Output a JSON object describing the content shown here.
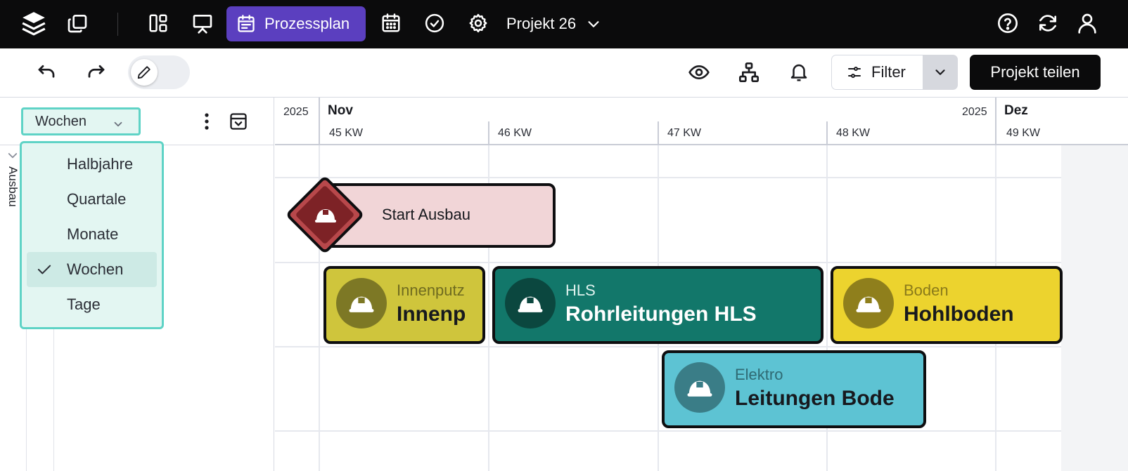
{
  "topbar": {
    "active_tab_label": "Prozessplan",
    "project_name": "Projekt 26"
  },
  "toolbar": {
    "filter_label": "Filter",
    "share_label": "Projekt teilen"
  },
  "left_panel": {
    "view_select_value": "Wochen",
    "group_label": "Ausbau"
  },
  "dropdown": {
    "items": [
      {
        "label": "Halbjahre"
      },
      {
        "label": "Quartale"
      },
      {
        "label": "Monate"
      },
      {
        "label": "Wochen",
        "selected": true
      },
      {
        "label": "Tage"
      }
    ]
  },
  "timeline": {
    "months": [
      {
        "year": "2025",
        "month": "Nov"
      },
      {
        "year": "2025",
        "month": "Dez"
      }
    ],
    "prev_year": "2025",
    "weeks": [
      "45 KW",
      "46 KW",
      "47 KW",
      "48 KW",
      "49 KW"
    ]
  },
  "milestone": {
    "label": "Start Ausbau",
    "icon": "hard-hat-icon",
    "color": "#b8484b"
  },
  "tasks": [
    {
      "category": "Innenputz",
      "name": "Innenp",
      "color": "#cfc53c",
      "icon": "hard-hat-icon"
    },
    {
      "category": "HLS",
      "name": "Rohrleitungen HLS",
      "color": "#12776a",
      "icon": "hard-hat-icon"
    },
    {
      "category": "Boden",
      "name": "Hohlboden",
      "color": "#ecd32e",
      "icon": "hard-hat-icon"
    },
    {
      "category": "Elektro",
      "name": "Leitungen Bode",
      "color": "#5dc3d3",
      "icon": "hard-hat-icon"
    }
  ],
  "colors": {
    "accent_purple": "#5b3fbf",
    "teal_highlight": "#5fd3c6"
  }
}
